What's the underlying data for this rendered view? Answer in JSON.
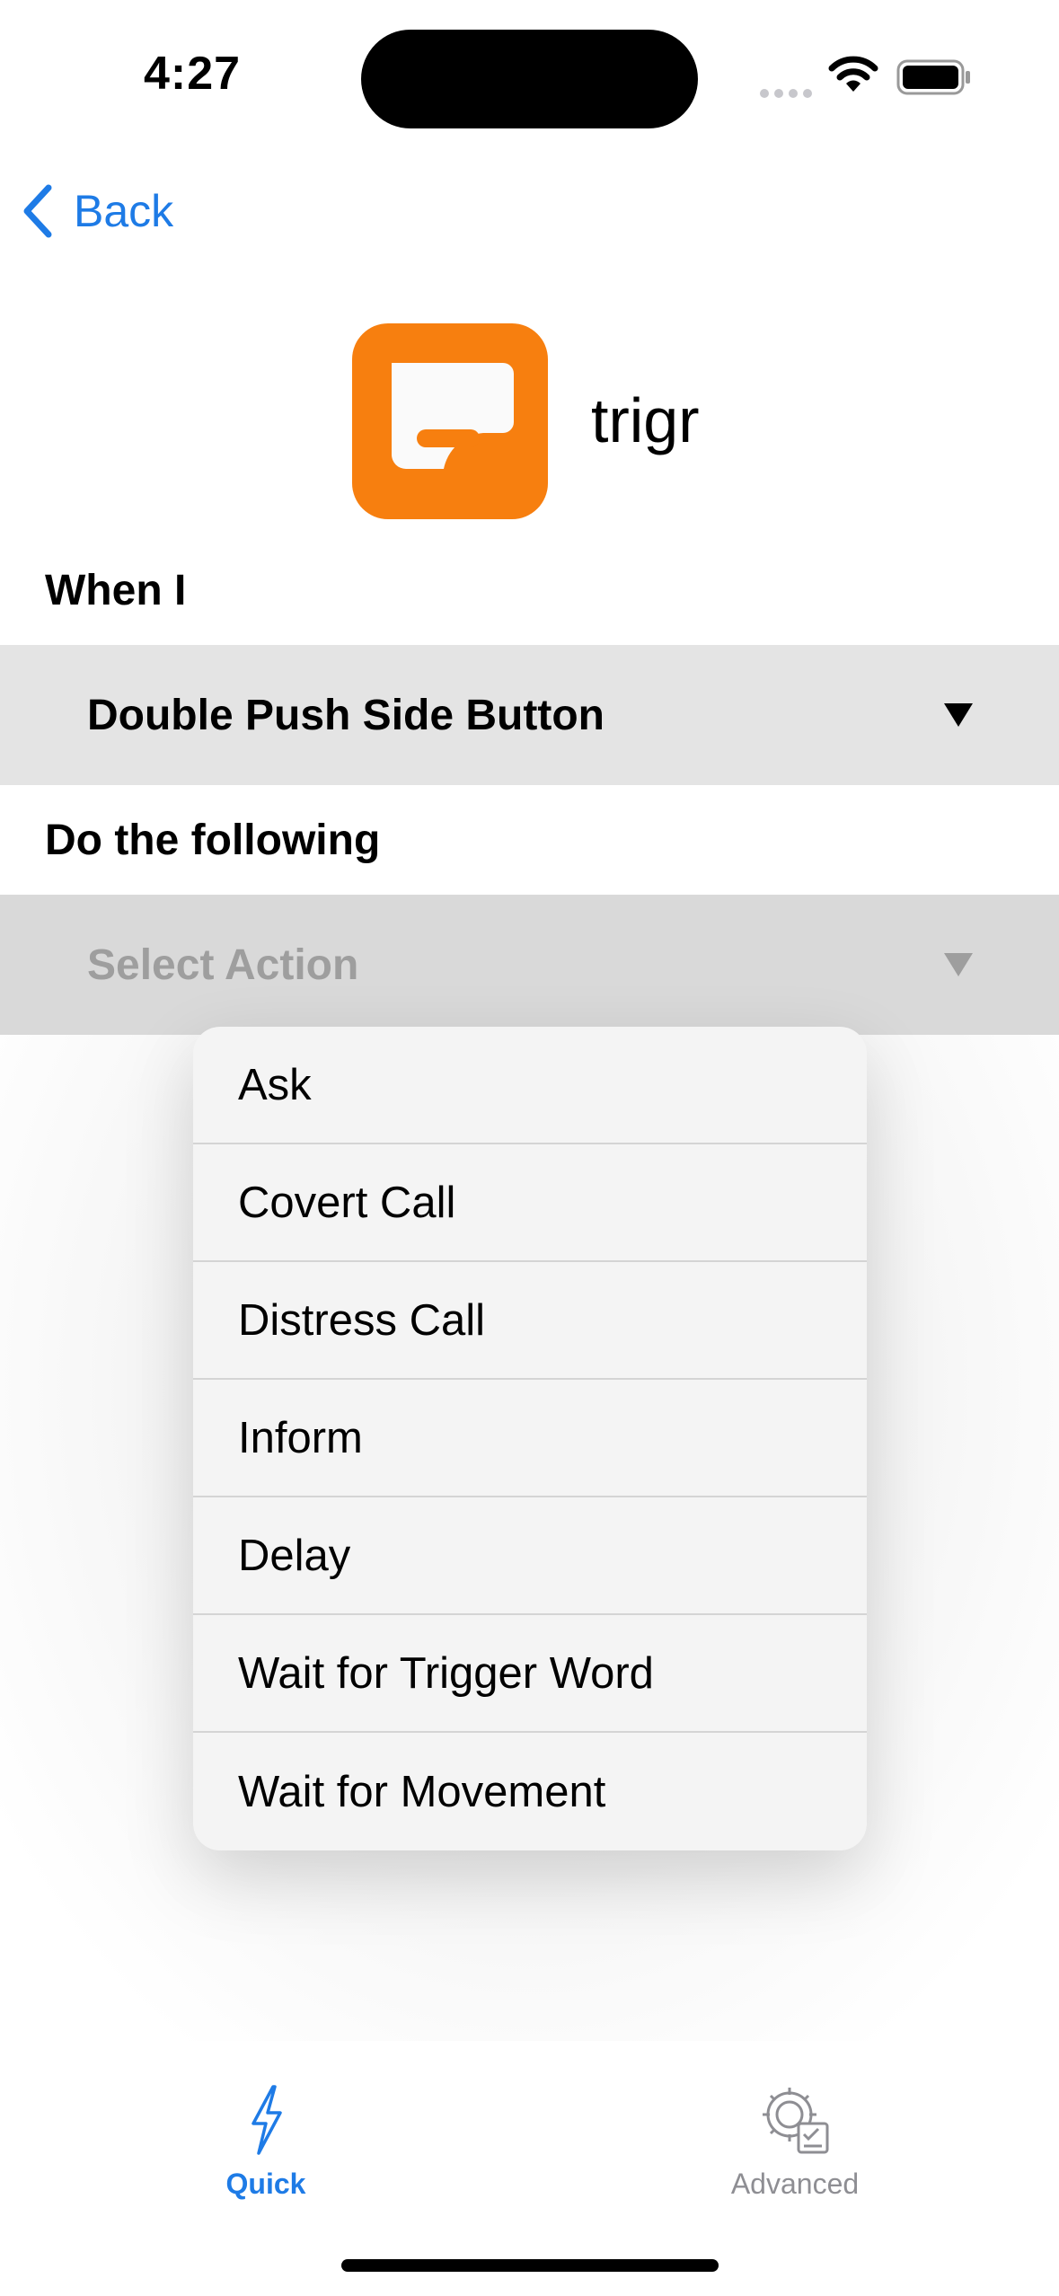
{
  "status_bar": {
    "time": "4:27",
    "icons": [
      "signal-dots-icon",
      "wifi-icon",
      "battery-icon"
    ]
  },
  "nav": {
    "back_label": "Back",
    "accent_color": "#1e7be6"
  },
  "app": {
    "name": "trigr",
    "icon_color": "#f77f0f"
  },
  "trigger": {
    "label": "When I",
    "selected": "Double Push Side Button"
  },
  "action": {
    "label": "Do the following",
    "placeholder": "Select Action"
  },
  "dropdown": {
    "options": [
      "Ask",
      "Covert Call",
      "Distress Call",
      "Inform",
      "Delay",
      "Wait for Trigger Word",
      "Wait for Movement"
    ]
  },
  "tab_bar": {
    "tabs": [
      {
        "label": "Quick",
        "icon": "lightning-icon",
        "active": true
      },
      {
        "label": "Advanced",
        "icon": "gear-checklist-icon",
        "active": false
      }
    ]
  }
}
